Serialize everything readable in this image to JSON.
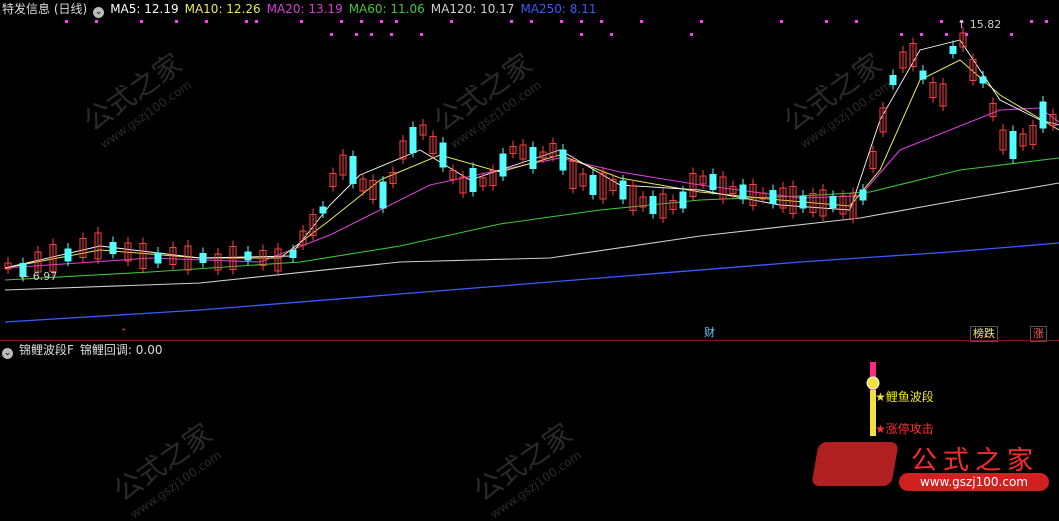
{
  "main_header": {
    "indicator_name": "特发信息 (日线)",
    "ma": [
      {
        "label": "MA5: 12.19",
        "color": "#ffffff"
      },
      {
        "label": "MA10: 12.26",
        "color": "#e8e85a"
      },
      {
        "label": "MA20: 13.19",
        "color": "#d83cd8"
      },
      {
        "label": "MA60: 11.06",
        "color": "#3cc83c"
      },
      {
        "label": "MA120: 10.17",
        "color": "#d0d0d0"
      },
      {
        "label": "MA250: 8.11",
        "color": "#3a5bff"
      }
    ]
  },
  "price_labels": {
    "high": "15.82",
    "low": "6.97"
  },
  "event_tags": {
    "cai": "财",
    "bangdie": "榜跌",
    "zhang": "涨"
  },
  "sub_header": {
    "indicator_name": "锦鲤波段F",
    "pullback": "锦鲤回调: 0.00"
  },
  "sub_labels": {
    "wave": "★鲤鱼波段",
    "limit": "★涨停攻击"
  },
  "watermark": {
    "brand": "公式之家",
    "url": "www.gszj100.com"
  },
  "colors": {
    "up": "#ff4040",
    "down": "#54ffff",
    "accent": "#ff3bff"
  }
}
